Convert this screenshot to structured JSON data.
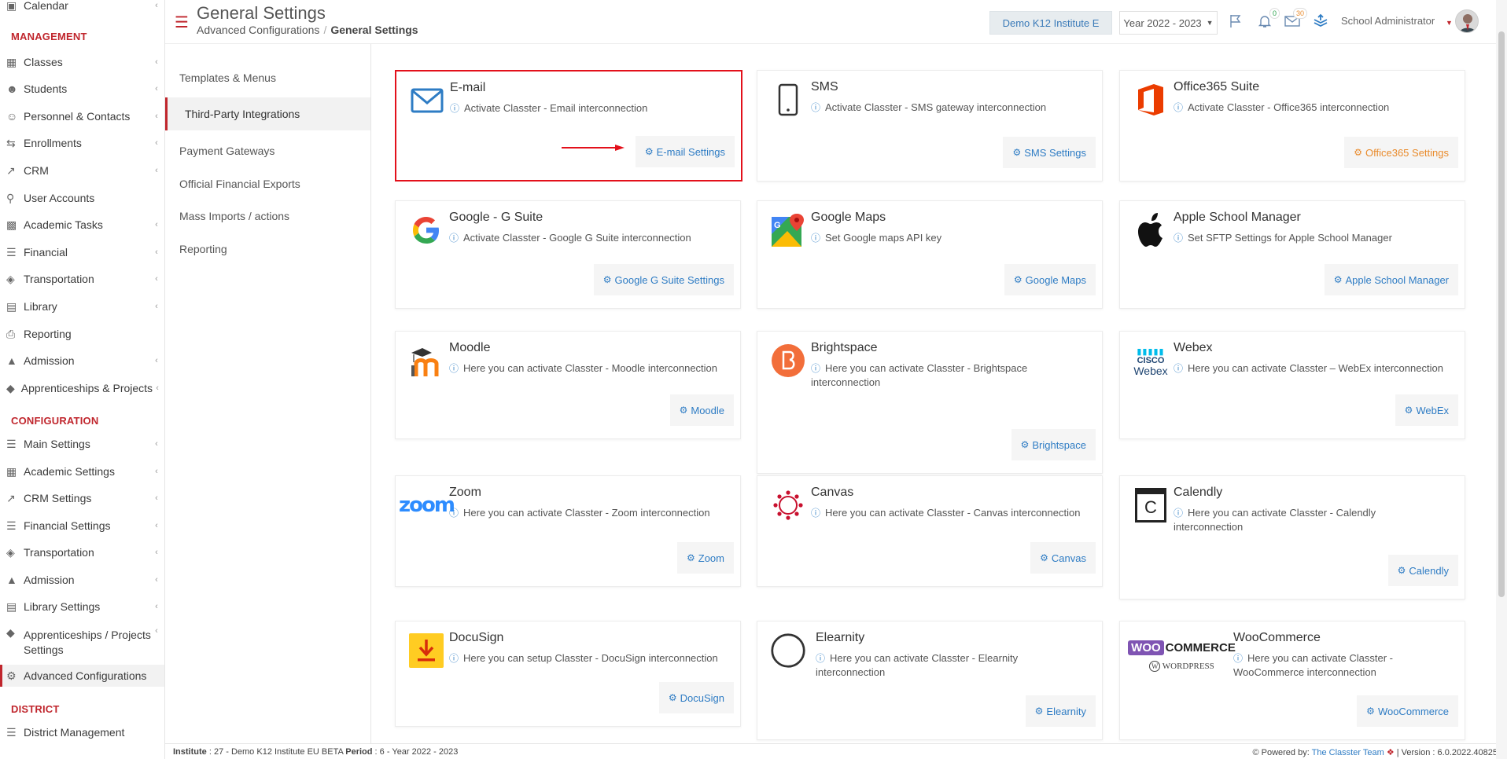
{
  "sidebar": {
    "top_item": {
      "label": "Calendar",
      "icon": "calendar-icon"
    },
    "sections": [
      {
        "title": "MANAGEMENT"
      },
      {
        "title": "CONFIGURATION"
      },
      {
        "title": "DISTRICT"
      }
    ],
    "management": [
      {
        "label": "Classes",
        "icon": "classes-icon"
      },
      {
        "label": "Students",
        "icon": "students-icon"
      },
      {
        "label": "Personnel & Contacts",
        "icon": "personnel-icon"
      },
      {
        "label": "Enrollments",
        "icon": "enrollments-icon"
      },
      {
        "label": "CRM",
        "icon": "crm-icon"
      },
      {
        "label": "User Accounts",
        "icon": "key-icon"
      },
      {
        "label": "Academic Tasks",
        "icon": "tasks-icon"
      },
      {
        "label": "Financial",
        "icon": "coins-icon"
      },
      {
        "label": "Transportation",
        "icon": "bus-icon"
      },
      {
        "label": "Library",
        "icon": "library-icon"
      },
      {
        "label": "Reporting",
        "icon": "printer-icon"
      },
      {
        "label": "Admission",
        "icon": "institution-icon"
      },
      {
        "label": "Apprenticeships & Projects",
        "icon": "cube-icon"
      }
    ],
    "configuration": [
      {
        "label": "Main Settings",
        "icon": "sliders-icon"
      },
      {
        "label": "Academic Settings",
        "icon": "classes-icon"
      },
      {
        "label": "CRM Settings",
        "icon": "crm-icon"
      },
      {
        "label": "Financial Settings",
        "icon": "coins-icon"
      },
      {
        "label": "Transportation",
        "icon": "bus-icon"
      },
      {
        "label": "Admission",
        "icon": "institution-icon"
      },
      {
        "label": "Library Settings",
        "icon": "library-icon"
      },
      {
        "label": "Apprenticeships / Projects Settings",
        "icon": "cube-icon"
      },
      {
        "label": "Advanced Configurations",
        "icon": "gears-icon"
      }
    ],
    "district": [
      {
        "label": "District Management",
        "icon": "list-icon"
      }
    ]
  },
  "header": {
    "title": "General Settings",
    "breadcrumb": [
      "Advanced Configurations",
      "General Settings"
    ],
    "institute": "Demo K12 Institute E",
    "year": "Year 2022 - 2023",
    "notifications_count": "0",
    "messages_count": "30",
    "user": "School Administrator"
  },
  "subnav": [
    "Templates & Menus",
    "Third-Party Integrations",
    "Payment Gateways",
    "Official Financial Exports",
    "Mass Imports / actions",
    "Reporting"
  ],
  "cards": [
    {
      "title": "E-mail",
      "desc": "Activate Classter - Email interconnection",
      "button": "E-mail Settings",
      "icon": "email-icon"
    },
    {
      "title": "SMS",
      "desc": "Activate Classter - SMS gateway interconnection",
      "button": "SMS Settings",
      "icon": "mobile-icon"
    },
    {
      "title": "Office365 Suite",
      "desc": "Activate Classter - Office365 interconnection",
      "button": "Office365 Settings",
      "icon": "office365-icon"
    },
    {
      "title": "Google - G Suite",
      "desc": "Activate Classter - Google G Suite interconnection",
      "button": "Google G Suite Settings",
      "icon": "google-icon"
    },
    {
      "title": "Google Maps",
      "desc": "Set Google maps API key",
      "button": "Google Maps",
      "icon": "google-maps-icon"
    },
    {
      "title": "Apple School Manager",
      "desc": "Set SFTP Settings for Apple School Manager",
      "button": "Apple School Manager",
      "icon": "apple-icon"
    },
    {
      "title": "Moodle",
      "desc": "Here you can activate Classter - Moodle interconnection",
      "button": "Moodle",
      "icon": "moodle-icon"
    },
    {
      "title": "Brightspace",
      "desc": "Here you can activate Classter - Brightspace interconnection",
      "button": "Brightspace",
      "icon": "brightspace-icon"
    },
    {
      "title": "Webex",
      "desc": "Here you can activate Classter – WebEx interconnection",
      "button": "WebEx",
      "icon": "webex-icon"
    },
    {
      "title": "Zoom",
      "desc": "Here you can activate Classter - Zoom interconnection",
      "button": "Zoom",
      "icon": "zoom-icon"
    },
    {
      "title": "Canvas",
      "desc": "Here you can activate Classter - Canvas interconnection",
      "button": "Canvas",
      "icon": "canvas-icon"
    },
    {
      "title": "Calendly",
      "desc": "Here you can activate Classter - Calendly interconnection",
      "button": "Calendly",
      "icon": "calendly-icon"
    },
    {
      "title": "DocuSign",
      "desc": "Here you can setup Classter - DocuSign interconnection",
      "button": "DocuSign",
      "icon": "docusign-icon"
    },
    {
      "title": "Elearnity",
      "desc": "Here you can activate Classter - Elearnity interconnection",
      "button": "Elearnity",
      "icon": "elearnity-icon"
    },
    {
      "title": "WooCommerce",
      "desc": "Here you can activate Classter - WooCommerce interconnection",
      "button": "WooCommerce",
      "icon": "woocommerce-icon"
    }
  ],
  "logo_text": {
    "zoom": "zoom",
    "cisco": "CISCO",
    "webex": "Webex",
    "woo": "WOO",
    "commerce": "COMMERCE",
    "wordpress": "WORDPRESS",
    "calendly": "C"
  },
  "footer": {
    "institute_label": "Institute",
    "institute_value": " : 27 - Demo K12 Institute EU BETA ",
    "period_label": "Period",
    "period_value": " : 6 - Year 2022 - 2023",
    "powered_by": "Powered by:",
    "team": "The Classter Team",
    "version": " | Version : 6.0.2022.40825"
  },
  "colors": {
    "accent": "#c0262d",
    "link": "#2e7cc4",
    "highlight": "#e3101b"
  }
}
